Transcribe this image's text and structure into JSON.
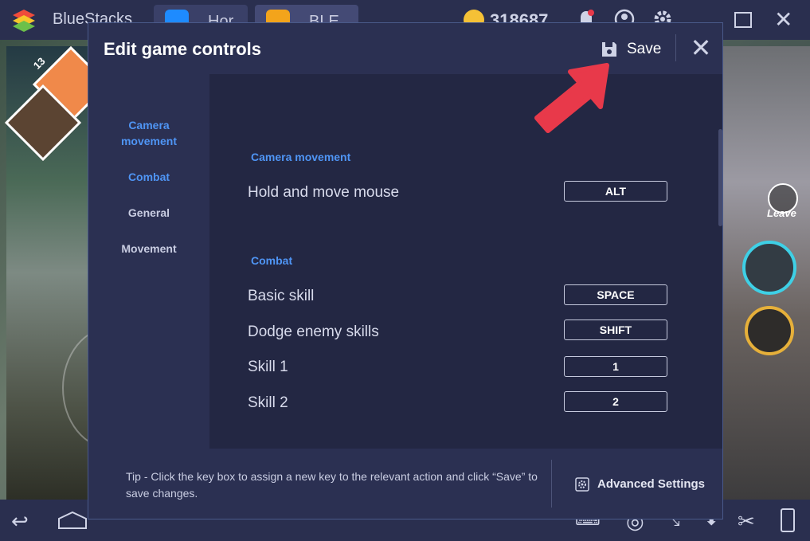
{
  "window": {
    "app_name": "BlueStacks",
    "tabs": [
      {
        "label": "Hor"
      },
      {
        "label": "BLE"
      }
    ],
    "coins": "318687"
  },
  "game": {
    "avatar_count": "13",
    "leave_label": "Leave"
  },
  "dialog": {
    "title": "Edit game controls",
    "save_label": "Save",
    "sidebar": [
      "Camera\nmovement",
      "Combat",
      "General",
      "Movement"
    ],
    "sections": {
      "camera": {
        "heading": "Camera movement",
        "rows": [
          {
            "action": "Hold and move mouse",
            "key": "ALT"
          }
        ]
      },
      "combat": {
        "heading": "Combat",
        "rows": [
          {
            "action": "Basic skill",
            "key": "SPACE"
          },
          {
            "action": "Dodge enemy skills",
            "key": "SHIFT"
          },
          {
            "action": "Skill 1",
            "key": "1"
          },
          {
            "action": "Skill 2",
            "key": "2"
          }
        ]
      }
    },
    "tip": "Tip - Click the key box to assign a new key to the relevant action and click “Save” to save changes.",
    "advanced_label": "Advanced Settings"
  },
  "colors": {
    "accent": "#4f95f5",
    "annotation_arrow": "#e8394a"
  },
  "icons": [
    "bluestacks-logo-icon",
    "coin-icon",
    "bell-icon",
    "location-icon",
    "gear-icon",
    "save-icon",
    "close-icon",
    "back-icon",
    "home-icon",
    "keyboard-icon",
    "scissors-icon",
    "phone-icon"
  ]
}
